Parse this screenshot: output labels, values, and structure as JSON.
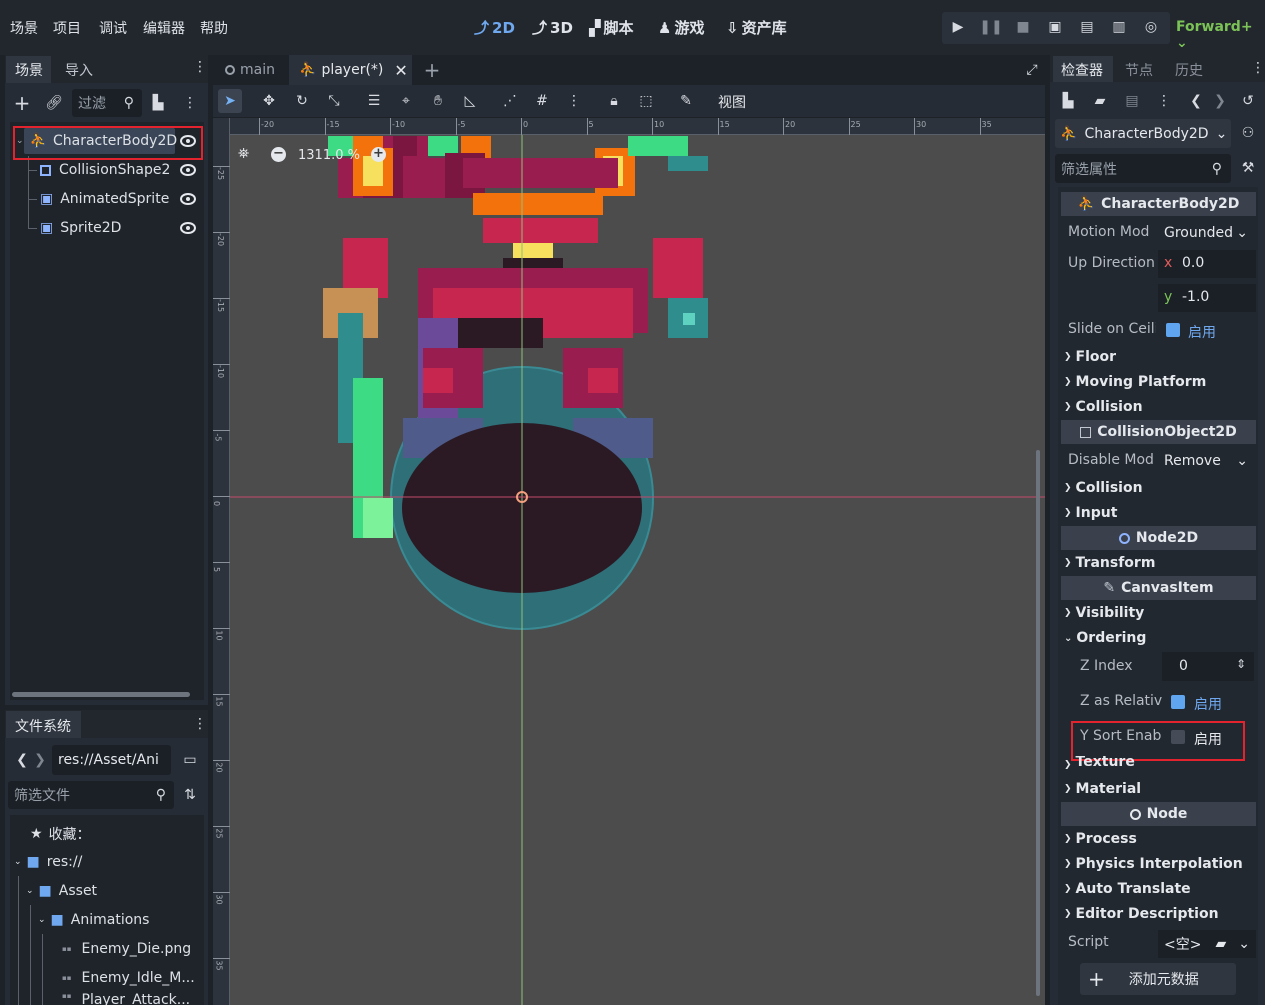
{
  "menu": [
    "场景",
    "项目",
    "调试",
    "编辑器",
    "帮助"
  ],
  "modes": [
    {
      "icon": "2d-icon",
      "label": "2D",
      "active": true
    },
    {
      "icon": "3d-icon",
      "label": "3D",
      "active": false
    },
    {
      "icon": "script-icon",
      "label": "脚本",
      "active": false
    },
    {
      "icon": "game-icon",
      "label": "游戏",
      "active": false
    },
    {
      "icon": "asset-lib-icon",
      "label": "资产库",
      "active": false
    }
  ],
  "renderer": "Forward+",
  "scene_dock": {
    "tabs": [
      "场景",
      "导入"
    ],
    "filter_placeholder": "过滤",
    "nodes": [
      {
        "name": "CharacterBody2D",
        "icon": "character-body-icon",
        "selected": true
      },
      {
        "name": "CollisionShape2",
        "icon": "collision-shape-icon"
      },
      {
        "name": "AnimatedSprite",
        "icon": "animated-sprite-icon"
      },
      {
        "name": "Sprite2D",
        "icon": "sprite-icon"
      }
    ]
  },
  "filesystem": {
    "tab": "文件系统",
    "path": "res://Asset/Ani",
    "filter_placeholder": "筛选文件",
    "items": [
      {
        "label": "收藏：",
        "icon": "star-icon"
      },
      {
        "label": "res://",
        "icon": "folder-icon"
      },
      {
        "label": "Asset",
        "icon": "folder-icon"
      },
      {
        "label": "Animations",
        "icon": "folder-icon"
      },
      {
        "label": "Enemy_Die.png",
        "icon": "image-icon"
      },
      {
        "label": "Enemy_Idle_M...",
        "icon": "image-icon"
      },
      {
        "label": "Player_Attack...",
        "icon": "image-icon"
      }
    ]
  },
  "scene_tabs": [
    {
      "label": "main",
      "icon": "node-icon"
    },
    {
      "label": "player(*)",
      "icon": "character-body-icon"
    }
  ],
  "viewport": {
    "view_menu": "视图",
    "zoom": "1311.0 %",
    "ruler_x": [
      "-20",
      "-15",
      "-10",
      "-5",
      "0",
      "5",
      "10",
      "15",
      "20",
      "25",
      "30",
      "35"
    ],
    "ruler_y": [
      "-25",
      "-20",
      "-15",
      "-10",
      "-5",
      "0",
      "5",
      "10",
      "15",
      "20",
      "25",
      "30",
      "35"
    ]
  },
  "inspector": {
    "tabs": [
      "检查器",
      "节点",
      "历史"
    ],
    "node_name": "CharacterBody2D",
    "filter_placeholder": "筛选属性",
    "categories": {
      "character_body": "CharacterBody2D",
      "collision_object": "CollisionObject2D",
      "node2d": "Node2D",
      "canvas_item": "CanvasItem",
      "node": "Node"
    },
    "motion_mode_label": "Motion Mod",
    "motion_mode_value": "Grounded",
    "up_direction_label": "Up Direction",
    "up_x": "0.0",
    "up_y": "-1.0",
    "axis_x": "x",
    "axis_y": "y",
    "slide_label": "Slide on Ceili",
    "enable": "启用",
    "sections_a": [
      "Floor",
      "Moving Platform",
      "Collision"
    ],
    "disable_mode_label": "Disable Mod",
    "disable_mode_value": "Remove",
    "sections_b": [
      "Collision",
      "Input"
    ],
    "transform": "Transform",
    "visibility": "Visibility",
    "ordering": "Ordering",
    "z_index_label": "Z Index",
    "z_index_value": "0",
    "z_relative_label": "Z as Relativ",
    "y_sort_label": "Y Sort Enabl",
    "sections_c": [
      "Texture",
      "Material"
    ],
    "sections_d": [
      "Process",
      "Physics Interpolation",
      "Auto Translate",
      "Editor Description"
    ],
    "script_label": "Script",
    "script_value": "<空>",
    "add_metadata": "添加元数据"
  }
}
